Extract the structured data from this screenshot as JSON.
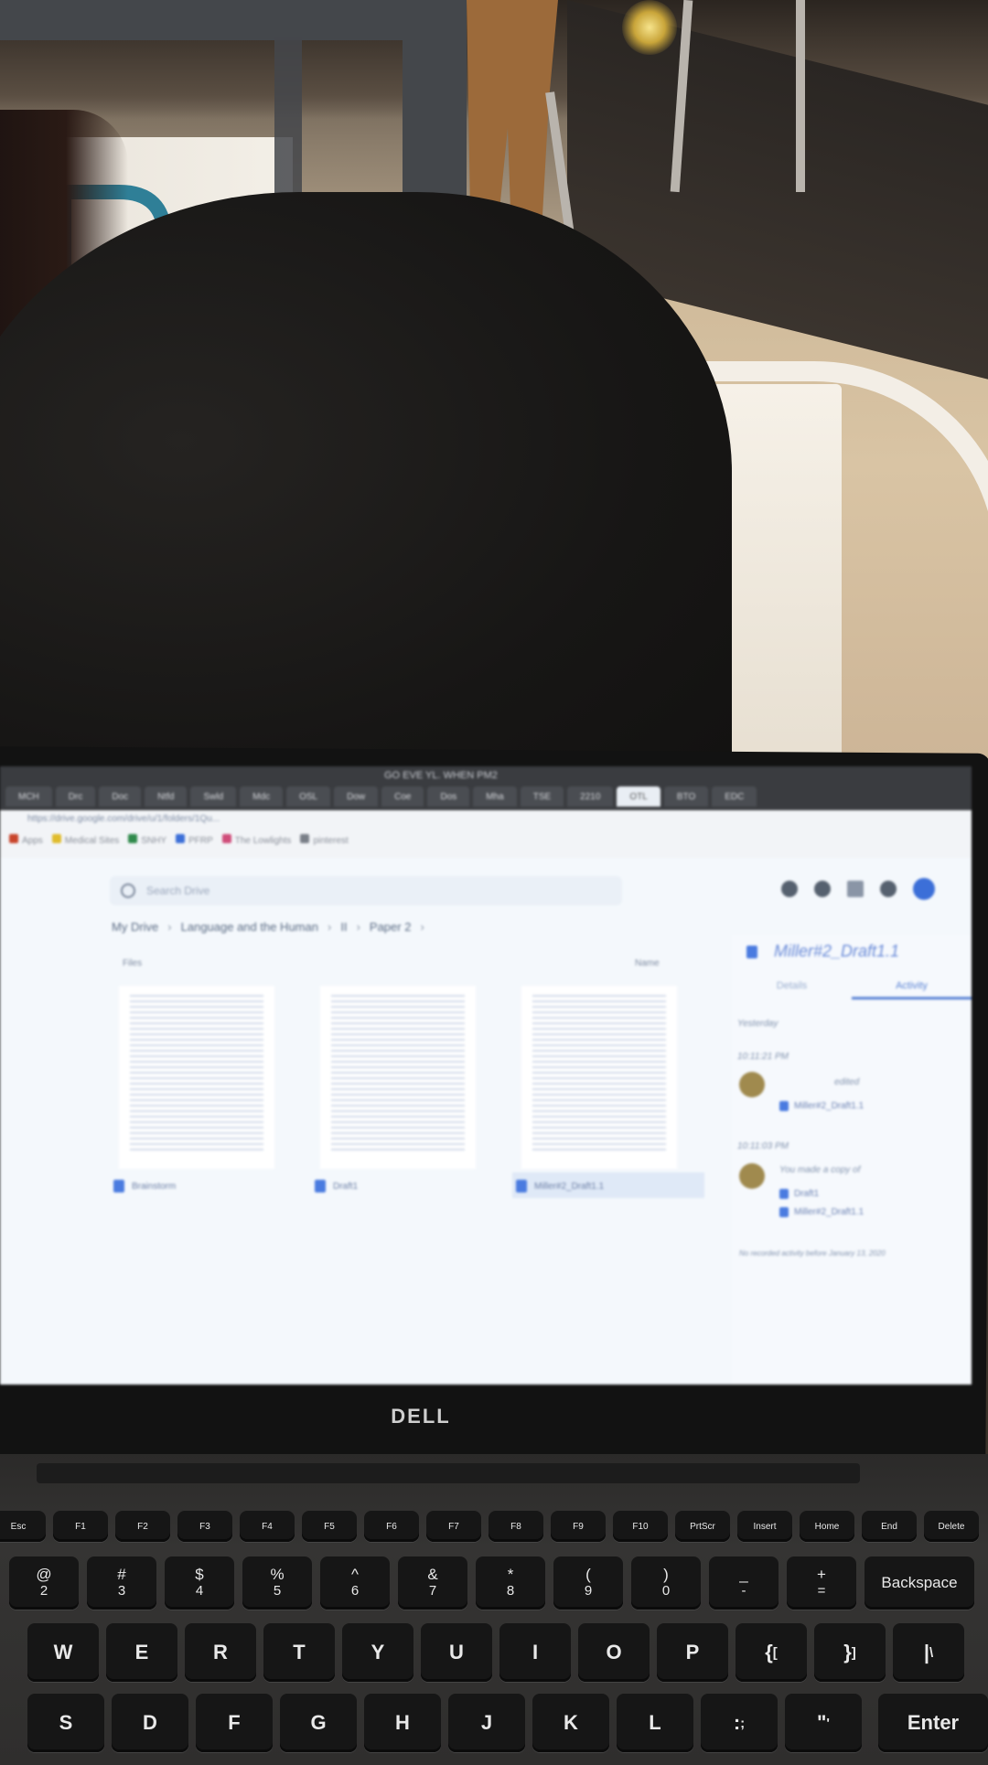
{
  "browser": {
    "window_title": "GO EVE YL. WHEN PM2",
    "tabs": [
      "MCH",
      "Drc",
      "Doc",
      "Ntfd",
      "Swld",
      "Mdc",
      "OSL",
      "Dow",
      "Coe",
      "Dos",
      "Mha",
      "TSE",
      "2210",
      "OTL",
      "BTO",
      "EDC"
    ],
    "active_tab_index": 13,
    "url": "https://drive.google.com/drive/u/1/folders/1Qu...",
    "bookmarks": [
      "Apps",
      "Medical Sites",
      "SNHY",
      "PFRP",
      "The Lowlights",
      "pinterest"
    ]
  },
  "drive": {
    "search_placeholder": "Search Drive",
    "breadcrumb": [
      "My Drive",
      "Language and the Human",
      "II",
      "Paper 2"
    ],
    "files_label": "Files",
    "sort_label": "Name",
    "files": [
      {
        "name": "Brainstorm"
      },
      {
        "name": "Draft1"
      },
      {
        "name": "Miller#2_Draft1.1"
      }
    ],
    "details_panel": {
      "doc_title": "Miller#2_Draft1.1",
      "tabs": [
        "Details",
        "Activity"
      ],
      "active_tab": "Activity",
      "section": "Yesterday",
      "events": [
        {
          "time": "10:11:21 PM",
          "action": "edited",
          "files": [
            "Miller#2_Draft1.1"
          ]
        },
        {
          "time": "10:11:03 PM",
          "action": "You made a copy of",
          "files": [
            "Draft1",
            "Miller#2_Draft1.1"
          ]
        }
      ],
      "footer_note": "No recorded activity before January 13, 2020"
    }
  },
  "bezel": {
    "brand": "DELL"
  },
  "keyboard": {
    "fn_row": [
      "Esc",
      "F1",
      "F2",
      "F3",
      "F4",
      "F5",
      "F6",
      "F7",
      "F8",
      "F9",
      "F10",
      "PrtScr",
      "Insert",
      "Home",
      "End",
      "Delete"
    ],
    "number_row": [
      {
        "top": "@",
        "bottom": "2"
      },
      {
        "top": "#",
        "bottom": "3"
      },
      {
        "top": "$",
        "bottom": "4"
      },
      {
        "top": "%",
        "bottom": "5"
      },
      {
        "top": "^",
        "bottom": "6"
      },
      {
        "top": "&",
        "bottom": "7"
      },
      {
        "top": "*",
        "bottom": "8"
      },
      {
        "top": "(",
        "bottom": "9"
      },
      {
        "top": ")",
        "bottom": "0"
      },
      {
        "top": "_",
        "bottom": "-"
      },
      {
        "top": "+",
        "bottom": "="
      }
    ],
    "backspace": "Backspace",
    "qwerty_row": [
      "W",
      "E",
      "R",
      "T",
      "Y",
      "U",
      "I",
      "O",
      "P",
      "{ [",
      "} ]",
      "| \\"
    ],
    "home_row": [
      "S",
      "D",
      "F",
      "G",
      "H",
      "J",
      "K",
      "L",
      ": ;",
      "\" '"
    ],
    "enter": "Enter"
  }
}
